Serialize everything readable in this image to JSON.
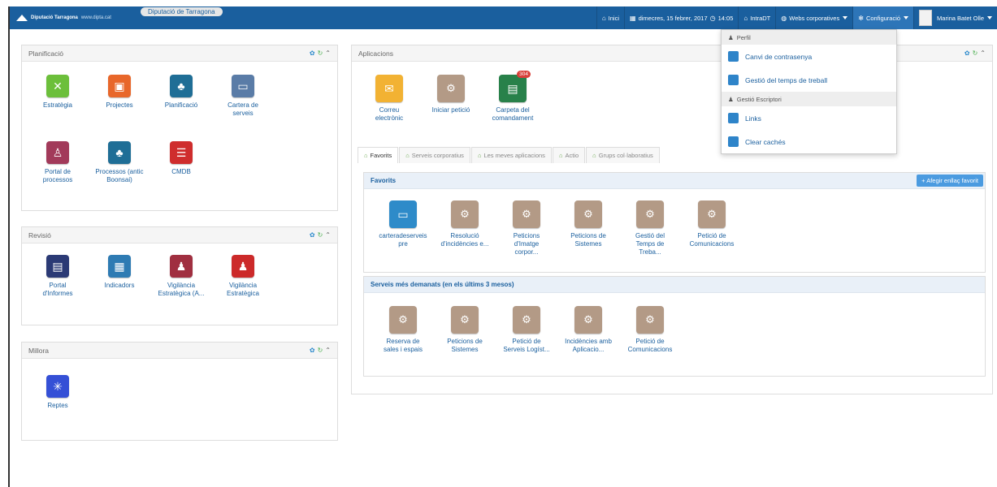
{
  "brand": {
    "name": "Diputació Tarragona",
    "url": "www.dipta.cat",
    "tenant": "Diputació de Tarragona"
  },
  "topnav": {
    "home": "Inici",
    "date": "dimecres, 15 febrer, 2017",
    "time": "14:05",
    "intradt": "IntraDT",
    "webs": "Webs corporatives",
    "config": "Configuració",
    "user": "Marina Batet Olle"
  },
  "dropdown": {
    "perfil": "Perfil",
    "password": "Canvi de contrasenya",
    "worktime": "Gestió del temps de treball",
    "desk": "Gestió Escriptori",
    "links": "Links",
    "clear": "Clear cachés"
  },
  "panels": {
    "planificacio": {
      "title": "Planificació",
      "items": [
        "Estratègia",
        "Projectes",
        "Planificació",
        "Cartera de serveis",
        "Portal de processos",
        "Processos (antic Boonsai)",
        "CMDB"
      ]
    },
    "revisio": {
      "title": "Revisió",
      "items": [
        "Portal d'Informes",
        "Indicadors",
        "Vigilància Estratègica (A...",
        "Vigilància Estratègica"
      ]
    },
    "millora": {
      "title": "Millora",
      "items": [
        "Reptes"
      ]
    },
    "aplicacions": {
      "title": "Aplicacions",
      "items": [
        "Correu electrònic",
        "Iniciar petició",
        "Carpeta del comandament"
      ],
      "badge": "304"
    }
  },
  "tabs": [
    "Favorits",
    "Serveis corporatius",
    "Les meves aplicacions",
    "Actio",
    "Grups col·laboratius"
  ],
  "favorits": {
    "title": "Favorits",
    "add": "Afegir enllaç favorit",
    "items": [
      "carteradeserveis pre",
      "Resolució d'incidències e...",
      "Peticions d'Imatge corpor...",
      "Peticions de Sistemes",
      "Gestió del Temps de Treba...",
      "Petició de Comunicacions"
    ]
  },
  "mesdemanats": {
    "title": "Serveis més demanats (en els últims 3 mesos)",
    "items": [
      "Reserva de sales i espais",
      "Peticions de Sistemes",
      "Petició de Serveis Logíst...",
      "Incidències amb Aplicacio...",
      "Petició de Comunicacions"
    ]
  }
}
